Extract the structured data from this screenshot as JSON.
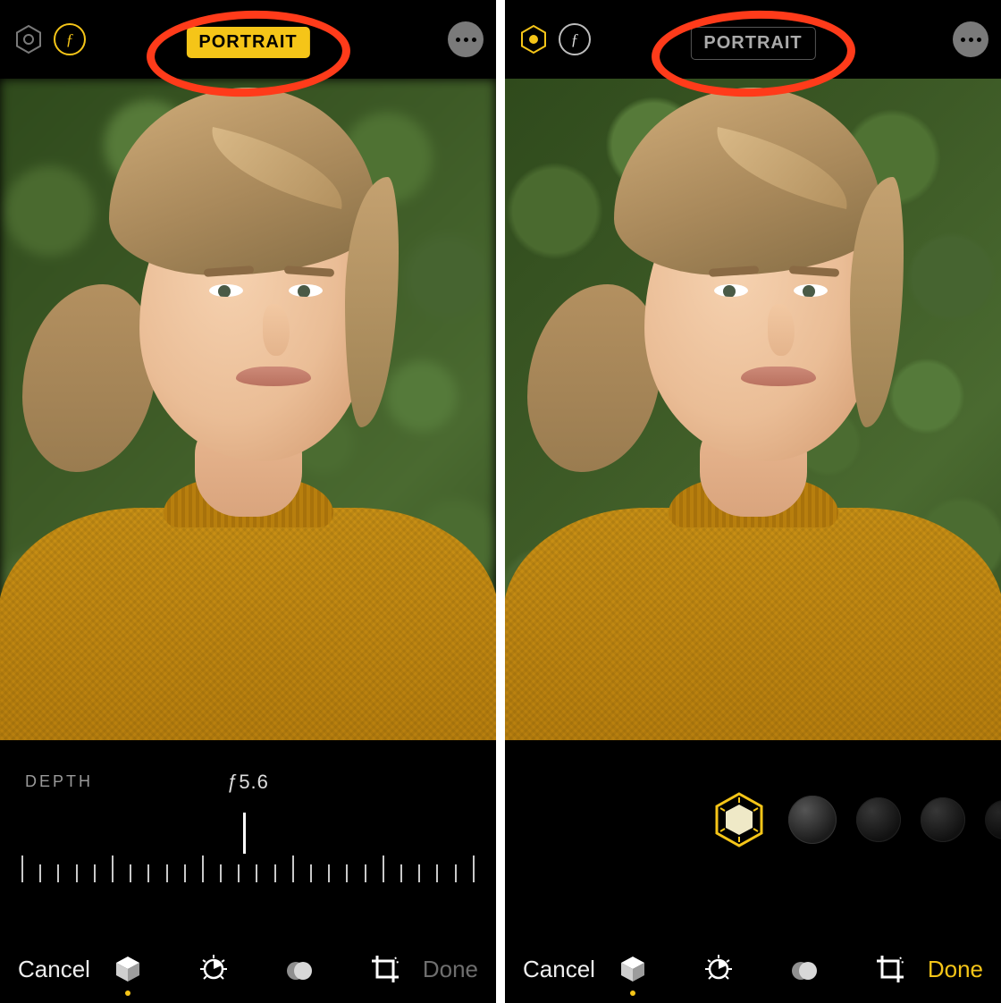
{
  "left": {
    "mode_label": "PORTRAIT",
    "mode_active": true,
    "depth_label": "DEPTH",
    "depth_value": "ƒ5.6",
    "cancel": "Cancel",
    "done": "Done",
    "done_enabled": false,
    "active_tool_index": 0,
    "icons": {
      "hex": "hexagon-lighting-icon",
      "f": "aperture-f-icon",
      "more": "more-icon",
      "tools": [
        "cube-icon",
        "adjust-dial-icon",
        "filters-icon",
        "crop-rotate-icon"
      ]
    },
    "annotation_circle": true
  },
  "right": {
    "mode_label": "PORTRAIT",
    "mode_active": false,
    "cancel": "Cancel",
    "done": "Done",
    "done_enabled": true,
    "active_tool_index": 0,
    "lighting_selected_index": 0,
    "lighting_options_visible": 4,
    "icons": {
      "hex": "hexagon-lighting-icon",
      "f": "aperture-f-icon",
      "more": "more-icon",
      "tools": [
        "cube-icon",
        "adjust-dial-icon",
        "filters-icon",
        "crop-rotate-icon"
      ]
    },
    "annotation_circle": true
  },
  "colors": {
    "accent": "#f5c518",
    "annotation": "#ff3b1a"
  },
  "photo_subject": "woman-in-mustard-sweater-against-hedge"
}
